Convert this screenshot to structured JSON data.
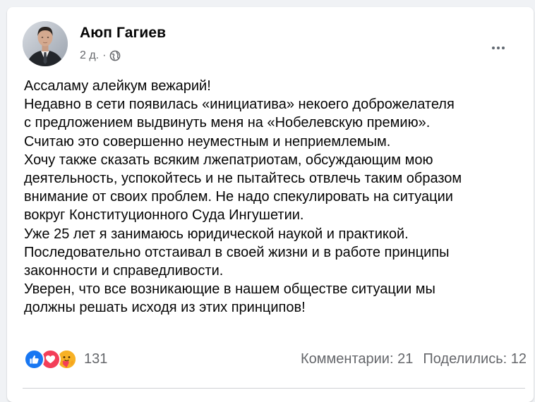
{
  "post": {
    "author": "Аюп Гагиев",
    "time": "2 д.",
    "separator": "·",
    "privacy_icon": "globe-icon",
    "more_icon": "more-options-icon",
    "lines": [
      "Ассаламу алейкум вежарий!",
      "Недавно в сети появилась  «инициатива» некоего доброжелателя",
      "с предложением выдвинуть меня на «Нобелевскую премию».",
      "Считаю это совершенно неуместным и неприемлемым.",
      "Хочу также сказать всяким лжепатриотам, обсуждающим мою",
      "деятельность, успокойтесь и не пытайтесь отвлечь таким образом",
      "внимание от своих проблем. Не надо спекулировать на ситуации",
      "вокруг Конституционного Суда Ингушетии.",
      "Уже 25 лет я занимаюсь юридической наукой и практикой.",
      "Последовательно отстаивал в своей жизни и в работе принципы",
      "законности и справедливости.",
      "Уверен, что все возникающие в нашем обществе ситуации мы",
      "должны решать исходя из этих принципов!"
    ]
  },
  "footer": {
    "reaction_icons": [
      "like-icon",
      "love-icon",
      "care-icon"
    ],
    "reactions_count": "131",
    "comments": "Комментарии: 21",
    "shares": "Поделились: 12"
  },
  "colors": {
    "background": "#f0f2f5",
    "card": "#ffffff",
    "text": "#050505",
    "secondary_text": "#65676b",
    "like": "#1877f2",
    "love": "#f33e58",
    "care": "#f7b125"
  }
}
